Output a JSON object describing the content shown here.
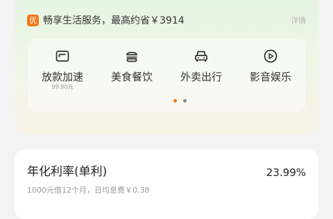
{
  "benefits": {
    "badge": "优",
    "header_text": "畅享生活服务，最高约省￥3914",
    "details_label": "详情",
    "services": [
      {
        "icon": "card-icon",
        "label": "放款加速",
        "sub": "99.90元"
      },
      {
        "icon": "burger-icon",
        "label": "美食餐饮",
        "sub": ""
      },
      {
        "icon": "car-icon",
        "label": "外卖出行",
        "sub": ""
      },
      {
        "icon": "play-icon",
        "label": "影音娱乐",
        "sub": ""
      }
    ],
    "pager": {
      "total": 2,
      "active": 1
    },
    "accent_color": "#f07a1d"
  },
  "rate": {
    "title": "年化利率(单利)",
    "value": "23.99%",
    "note": "1000元借12个月，日均息费￥0.38"
  }
}
